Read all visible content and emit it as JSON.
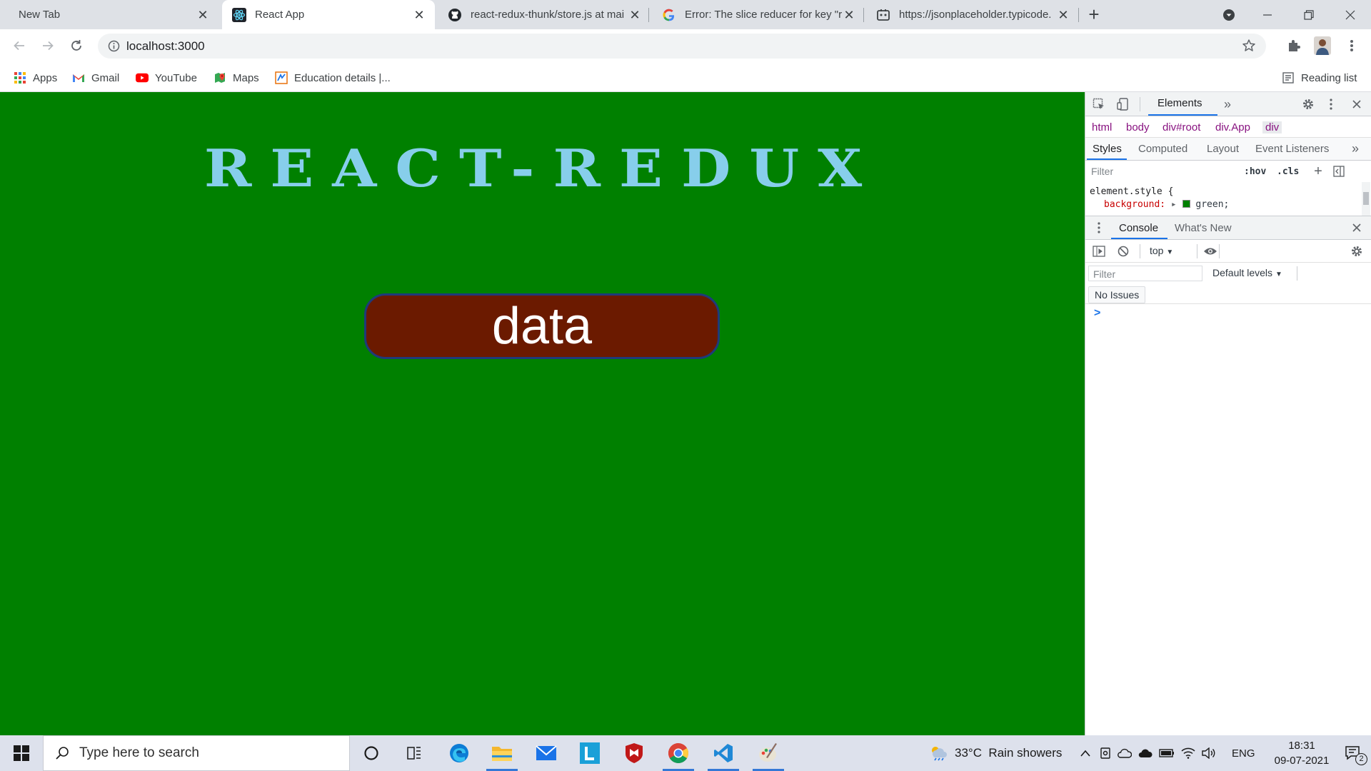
{
  "tabs": [
    {
      "title": "New Tab",
      "icon": "none",
      "active": false
    },
    {
      "title": "React App",
      "icon": "react-icon",
      "active": true
    },
    {
      "title": "react-redux-thunk/store.js at mai",
      "icon": "github-icon",
      "active": false
    },
    {
      "title": "Error: The slice reducer for key \"r",
      "icon": "google-icon",
      "active": false
    },
    {
      "title": "https://jsonplaceholder.typicode.",
      "icon": "jsonplaceholder-icon",
      "active": false
    }
  ],
  "address_bar": {
    "url": "localhost:3000"
  },
  "toolbar": {
    "reading_list_label": "Reading list"
  },
  "bookmarks": [
    {
      "label": "Apps",
      "icon": "apps-grid-icon"
    },
    {
      "label": "Gmail",
      "icon": "gmail-icon"
    },
    {
      "label": "YouTube",
      "icon": "youtube-icon"
    },
    {
      "label": "Maps",
      "icon": "maps-icon"
    },
    {
      "label": "Education details |...",
      "icon": "education-icon"
    }
  ],
  "page": {
    "heading": "REACT-REDUX",
    "button_label": "data",
    "colors": {
      "background": "#008000",
      "heading": "#87ceeb",
      "button": "#6b1a00"
    }
  },
  "devtools": {
    "main_tabs": [
      "Elements"
    ],
    "breadcrumbs": [
      "html",
      "body",
      "div#root",
      "div.App",
      "div"
    ],
    "style_tabs": [
      "Styles",
      "Computed",
      "Layout",
      "Event Listeners"
    ],
    "styles_filter_placeholder": "Filter",
    "hov_label": ":hov",
    "cls_label": ".cls",
    "rule_selector": "element.style {",
    "rule_property": "background:",
    "rule_value": "green;",
    "drawer_tabs": [
      "Console",
      "What's New"
    ],
    "context": "top",
    "console_filter_placeholder": "Filter",
    "levels": "Default levels",
    "issues": "No Issues",
    "prompt": ">"
  },
  "taskbar": {
    "search_placeholder": "Type here to search",
    "weather": "33°C  Rain showers",
    "language": "ENG",
    "time": "18:31",
    "date": "09-07-2021",
    "notifications": "2"
  }
}
